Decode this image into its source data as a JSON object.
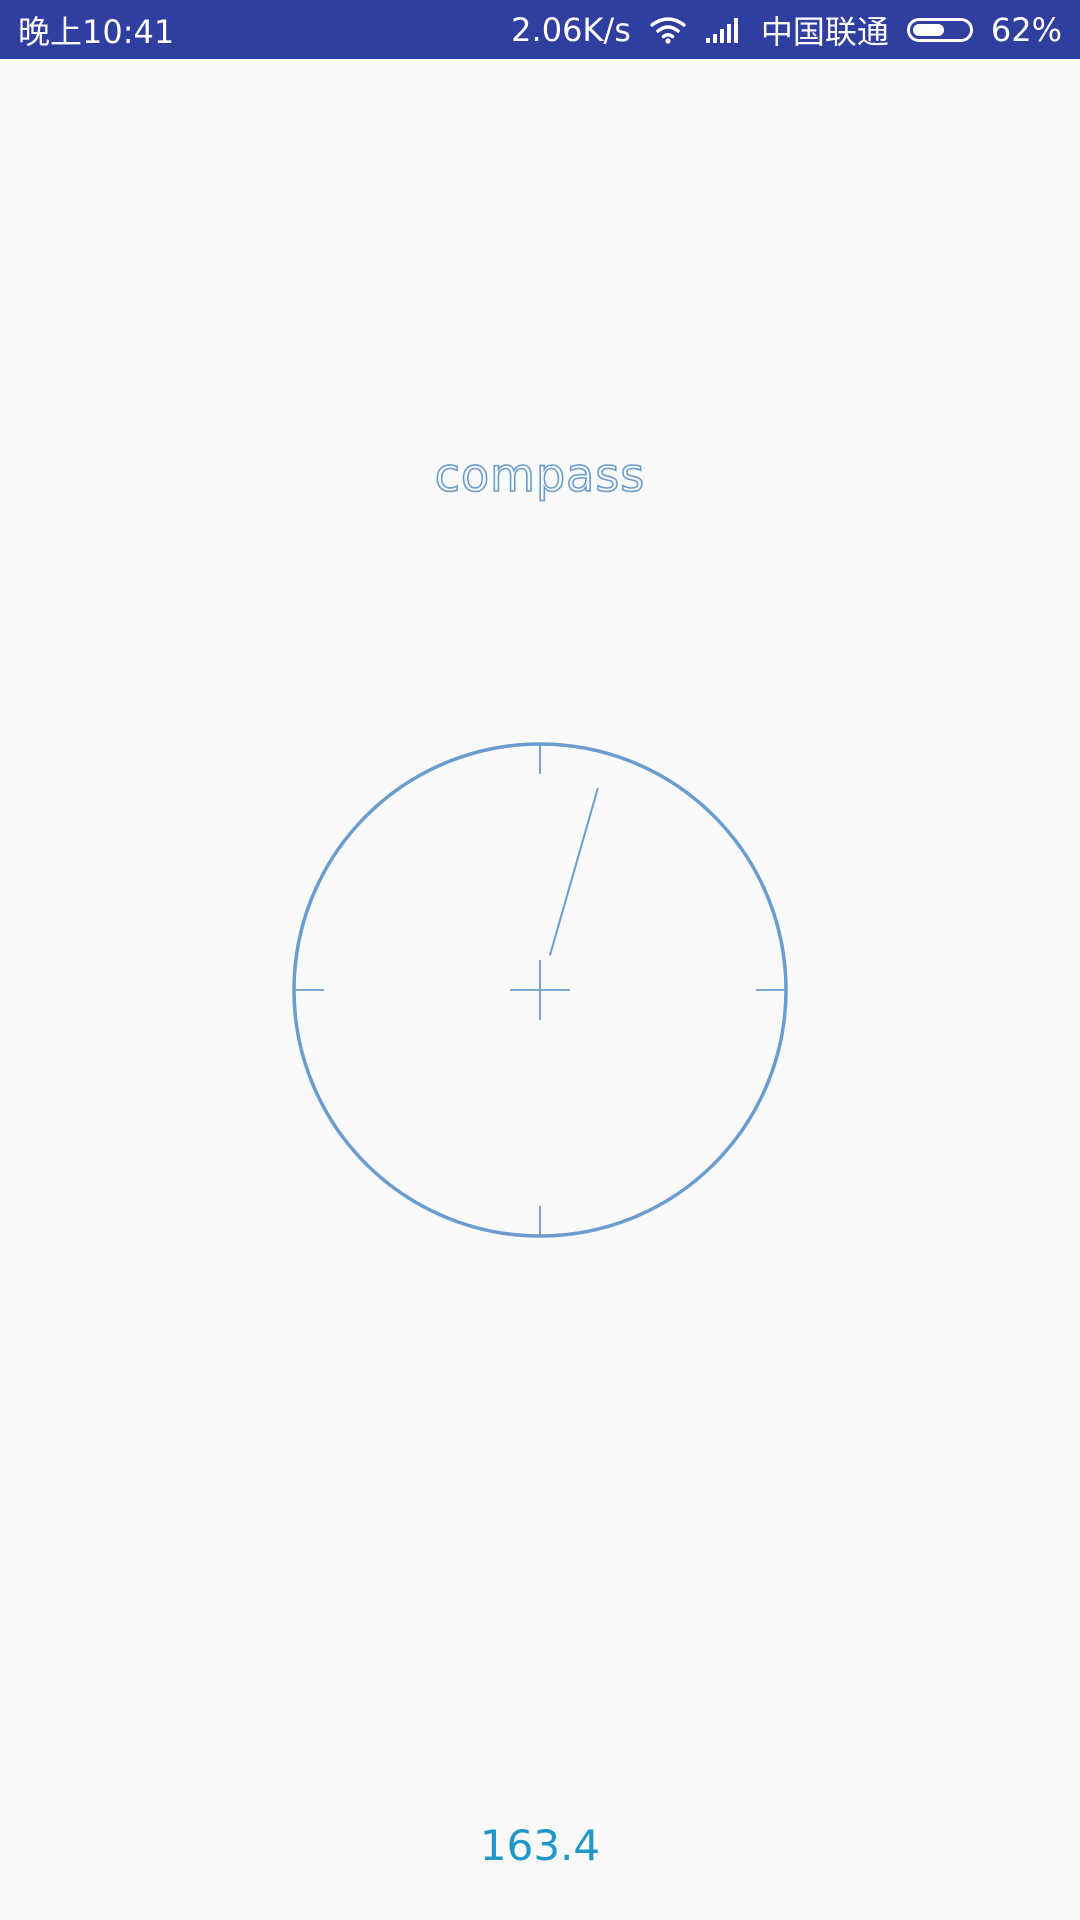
{
  "status_bar": {
    "time": "晚上10:41",
    "net_speed": "2.06K/s",
    "carrier": "中国联通",
    "battery_text": "62%",
    "battery_level": 0.62,
    "wifi_icon": "wifi-icon",
    "signal_icon": "signal-icon"
  },
  "title": "compass",
  "compass": {
    "heading_degrees": 163.4,
    "needle_angle_degrees": 16,
    "accent_color": "#6a9ccf"
  },
  "reading": "163.4",
  "colors": {
    "status_bar": "#303f9f",
    "background": "#fafafa",
    "accent": "#6a9ccf",
    "reading": "#2196c8"
  }
}
